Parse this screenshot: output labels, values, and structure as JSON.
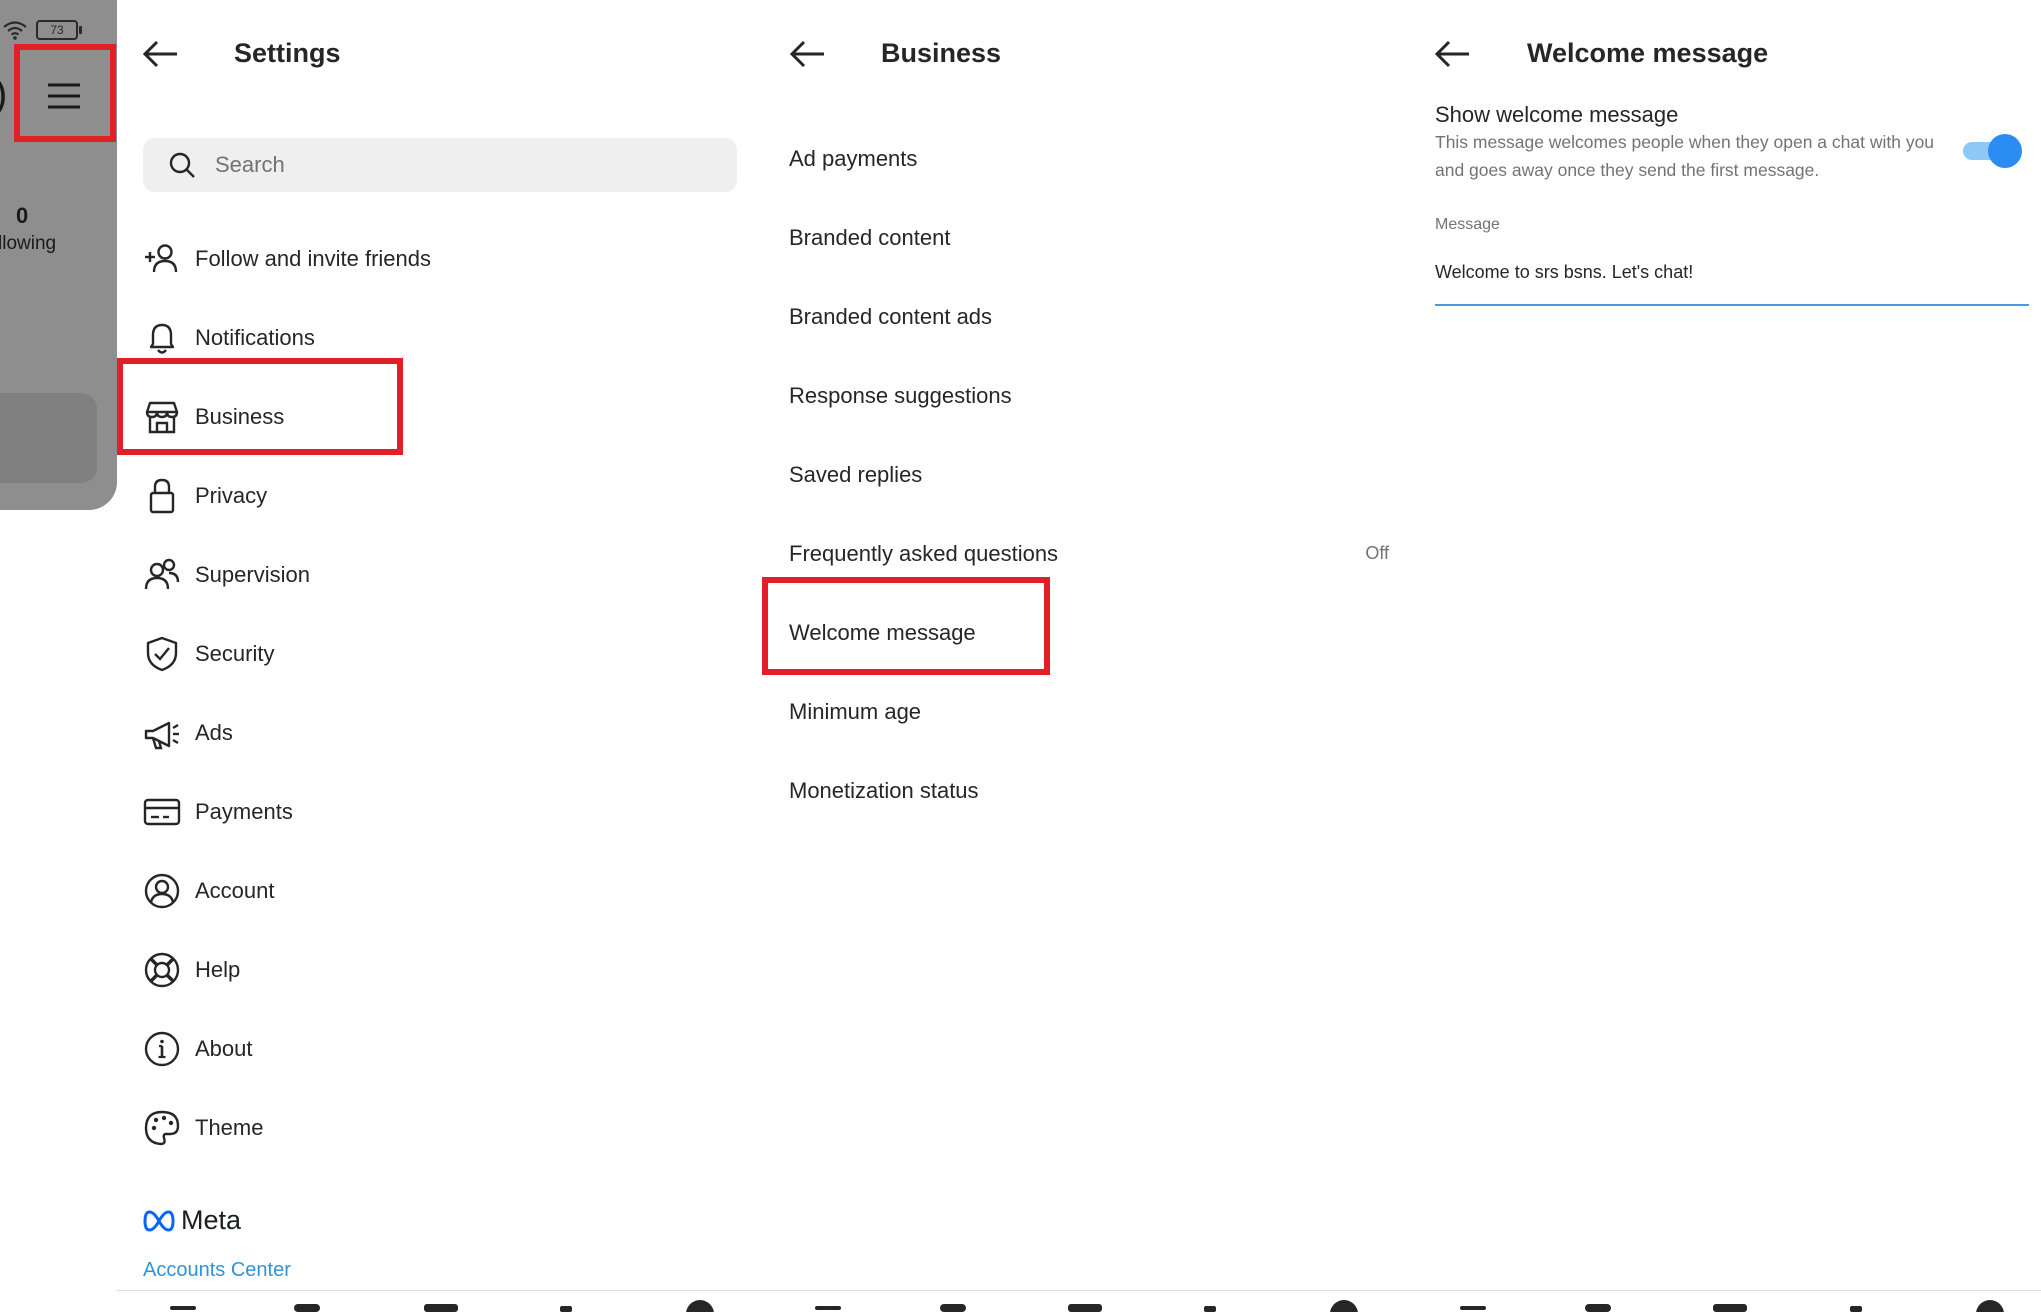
{
  "status_bar": {
    "battery": "73"
  },
  "profile": {
    "following_count": "0",
    "following_label": "llowing"
  },
  "settings": {
    "title": "Settings",
    "search_placeholder": "Search",
    "items": [
      {
        "label": "Follow and invite friends",
        "icon": "add-person-icon"
      },
      {
        "label": "Notifications",
        "icon": "bell-icon"
      },
      {
        "label": "Business",
        "icon": "shop-icon"
      },
      {
        "label": "Privacy",
        "icon": "lock-icon"
      },
      {
        "label": "Supervision",
        "icon": "people-icon"
      },
      {
        "label": "Security",
        "icon": "shield-check-icon"
      },
      {
        "label": "Ads",
        "icon": "megaphone-icon"
      },
      {
        "label": "Payments",
        "icon": "card-icon"
      },
      {
        "label": "Account",
        "icon": "account-circle-icon"
      },
      {
        "label": "Help",
        "icon": "lifebuoy-icon"
      },
      {
        "label": "About",
        "icon": "info-icon"
      },
      {
        "label": "Theme",
        "icon": "palette-icon"
      }
    ],
    "meta_label": "Meta",
    "accounts_center": "Accounts Center"
  },
  "business": {
    "title": "Business",
    "items": [
      {
        "label": "Ad payments",
        "value": ""
      },
      {
        "label": "Branded content",
        "value": ""
      },
      {
        "label": "Branded content ads",
        "value": ""
      },
      {
        "label": "Response suggestions",
        "value": ""
      },
      {
        "label": "Saved replies",
        "value": ""
      },
      {
        "label": "Frequently asked questions",
        "value": "Off"
      },
      {
        "label": "Welcome message",
        "value": ""
      },
      {
        "label": "Minimum age",
        "value": ""
      },
      {
        "label": "Monetization status",
        "value": ""
      }
    ]
  },
  "welcome": {
    "title": "Welcome message",
    "toggle_label": "Show welcome message",
    "description": "This message welcomes people when they open a chat with you and goes away once they send the first message.",
    "toggle_on": true,
    "message_label": "Message",
    "message_value": "Welcome to srs bsns. Let's chat!"
  },
  "colors": {
    "highlight": "#e21f26",
    "accent": "#2b8df2",
    "link": "#2f93d6"
  }
}
